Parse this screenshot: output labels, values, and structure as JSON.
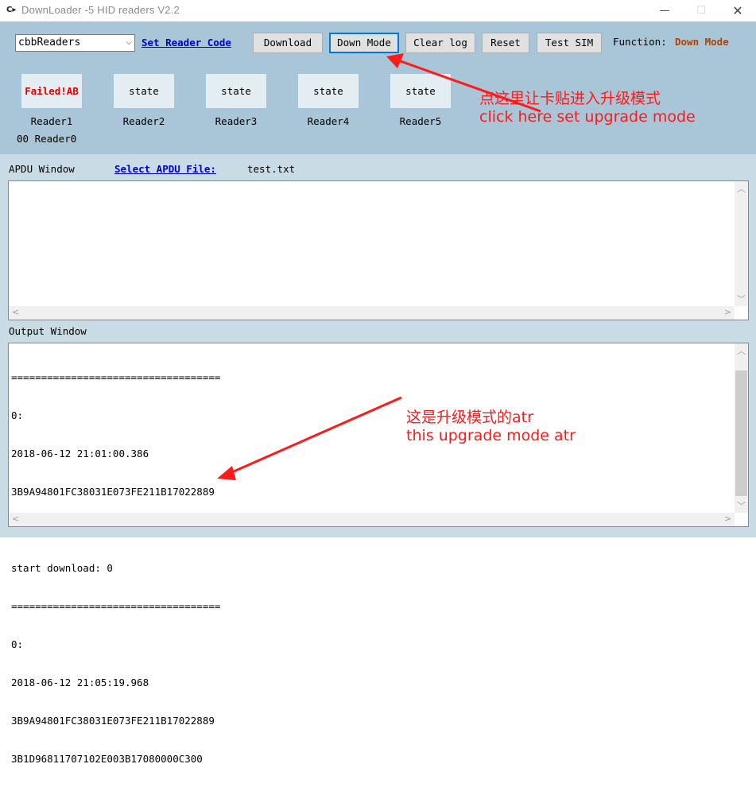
{
  "window": {
    "title": "DownLoader -5 HID readers V2.2",
    "icon_text": "C▸",
    "min_symbol": "—",
    "max_symbol": "☐",
    "close_symbol": "✕"
  },
  "toolbar": {
    "reader_select_value": "cbbReaders",
    "set_reader_code_link": "Set Reader Code",
    "download_label": "Download",
    "down_mode_label": "Down Mode",
    "clear_log_label": "Clear log",
    "reset_label": "Reset",
    "test_sim_label": "Test SIM",
    "function_label": "Function:",
    "function_value": "Down Mode"
  },
  "readers": [
    {
      "state": "Failed!AB",
      "label": "Reader1"
    },
    {
      "state": "state",
      "label": "Reader2"
    },
    {
      "state": "state",
      "label": "Reader3"
    },
    {
      "state": "state",
      "label": "Reader4"
    },
    {
      "state": "state",
      "label": "Reader5"
    }
  ],
  "reader0_label": "00 Reader0",
  "annotations": {
    "top_cn": "点这里让卡贴进入升级模式",
    "top_en": "click here set upgrade mode",
    "bottom_cn": "这是升级模式的atr",
    "bottom_en": "this upgrade mode atr",
    "color": "#ff1a1a"
  },
  "apdu": {
    "window_label": "APDU Window",
    "select_file_link": "Select APDU File:",
    "file_name": "test.txt"
  },
  "output": {
    "window_label": "Output Window",
    "lines": [
      "===================================",
      "0:",
      "2018-06-12 21:01:00.386",
      "3B9A94801FC38031E073FE211B17022889",
      "",
      "start download: 0",
      "===================================",
      "0:",
      "2018-06-12 21:05:19.968",
      "3B9A94801FC38031E073FE211B17022889",
      "3B1D96811707102E003B17080000C300"
    ]
  },
  "colors": {
    "panel": "#a8c6d7",
    "band": "#c9dce6",
    "accent": "#0078d7",
    "function_value": "#b04000"
  }
}
